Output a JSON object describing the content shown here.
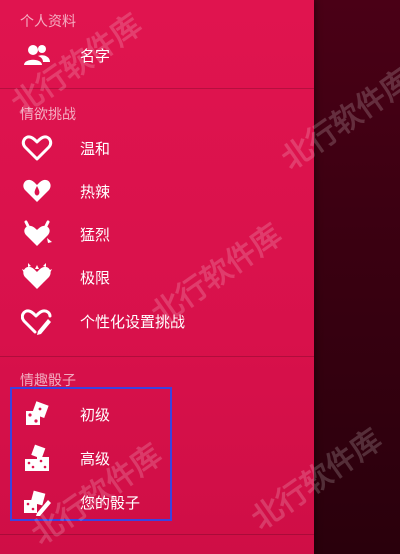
{
  "sections": {
    "profile": {
      "title": "个人资料",
      "items": [
        {
          "label": "名字",
          "icon": "users-icon"
        }
      ]
    },
    "challenges": {
      "title": "情欲挑战",
      "items": [
        {
          "label": "温和",
          "icon": "heart-outline-icon"
        },
        {
          "label": "热辣",
          "icon": "heart-drop-icon"
        },
        {
          "label": "猛烈",
          "icon": "heart-devil-icon"
        },
        {
          "label": "极限",
          "icon": "heart-flame-icon"
        },
        {
          "label": "个性化设置挑战",
          "icon": "heart-pencil-icon"
        }
      ]
    },
    "dice": {
      "title": "情趣骰子",
      "items": [
        {
          "label": "初级",
          "icon": "dice-two-icon"
        },
        {
          "label": "高级",
          "icon": "dice-three-icon"
        },
        {
          "label": "您的骰子",
          "icon": "dice-pencil-icon"
        }
      ]
    }
  },
  "watermark": "北行软件库",
  "colors": {
    "drawer_bg": "#dc124d",
    "right_bg": "#3a0011",
    "highlight_border": "#3a43e0"
  }
}
